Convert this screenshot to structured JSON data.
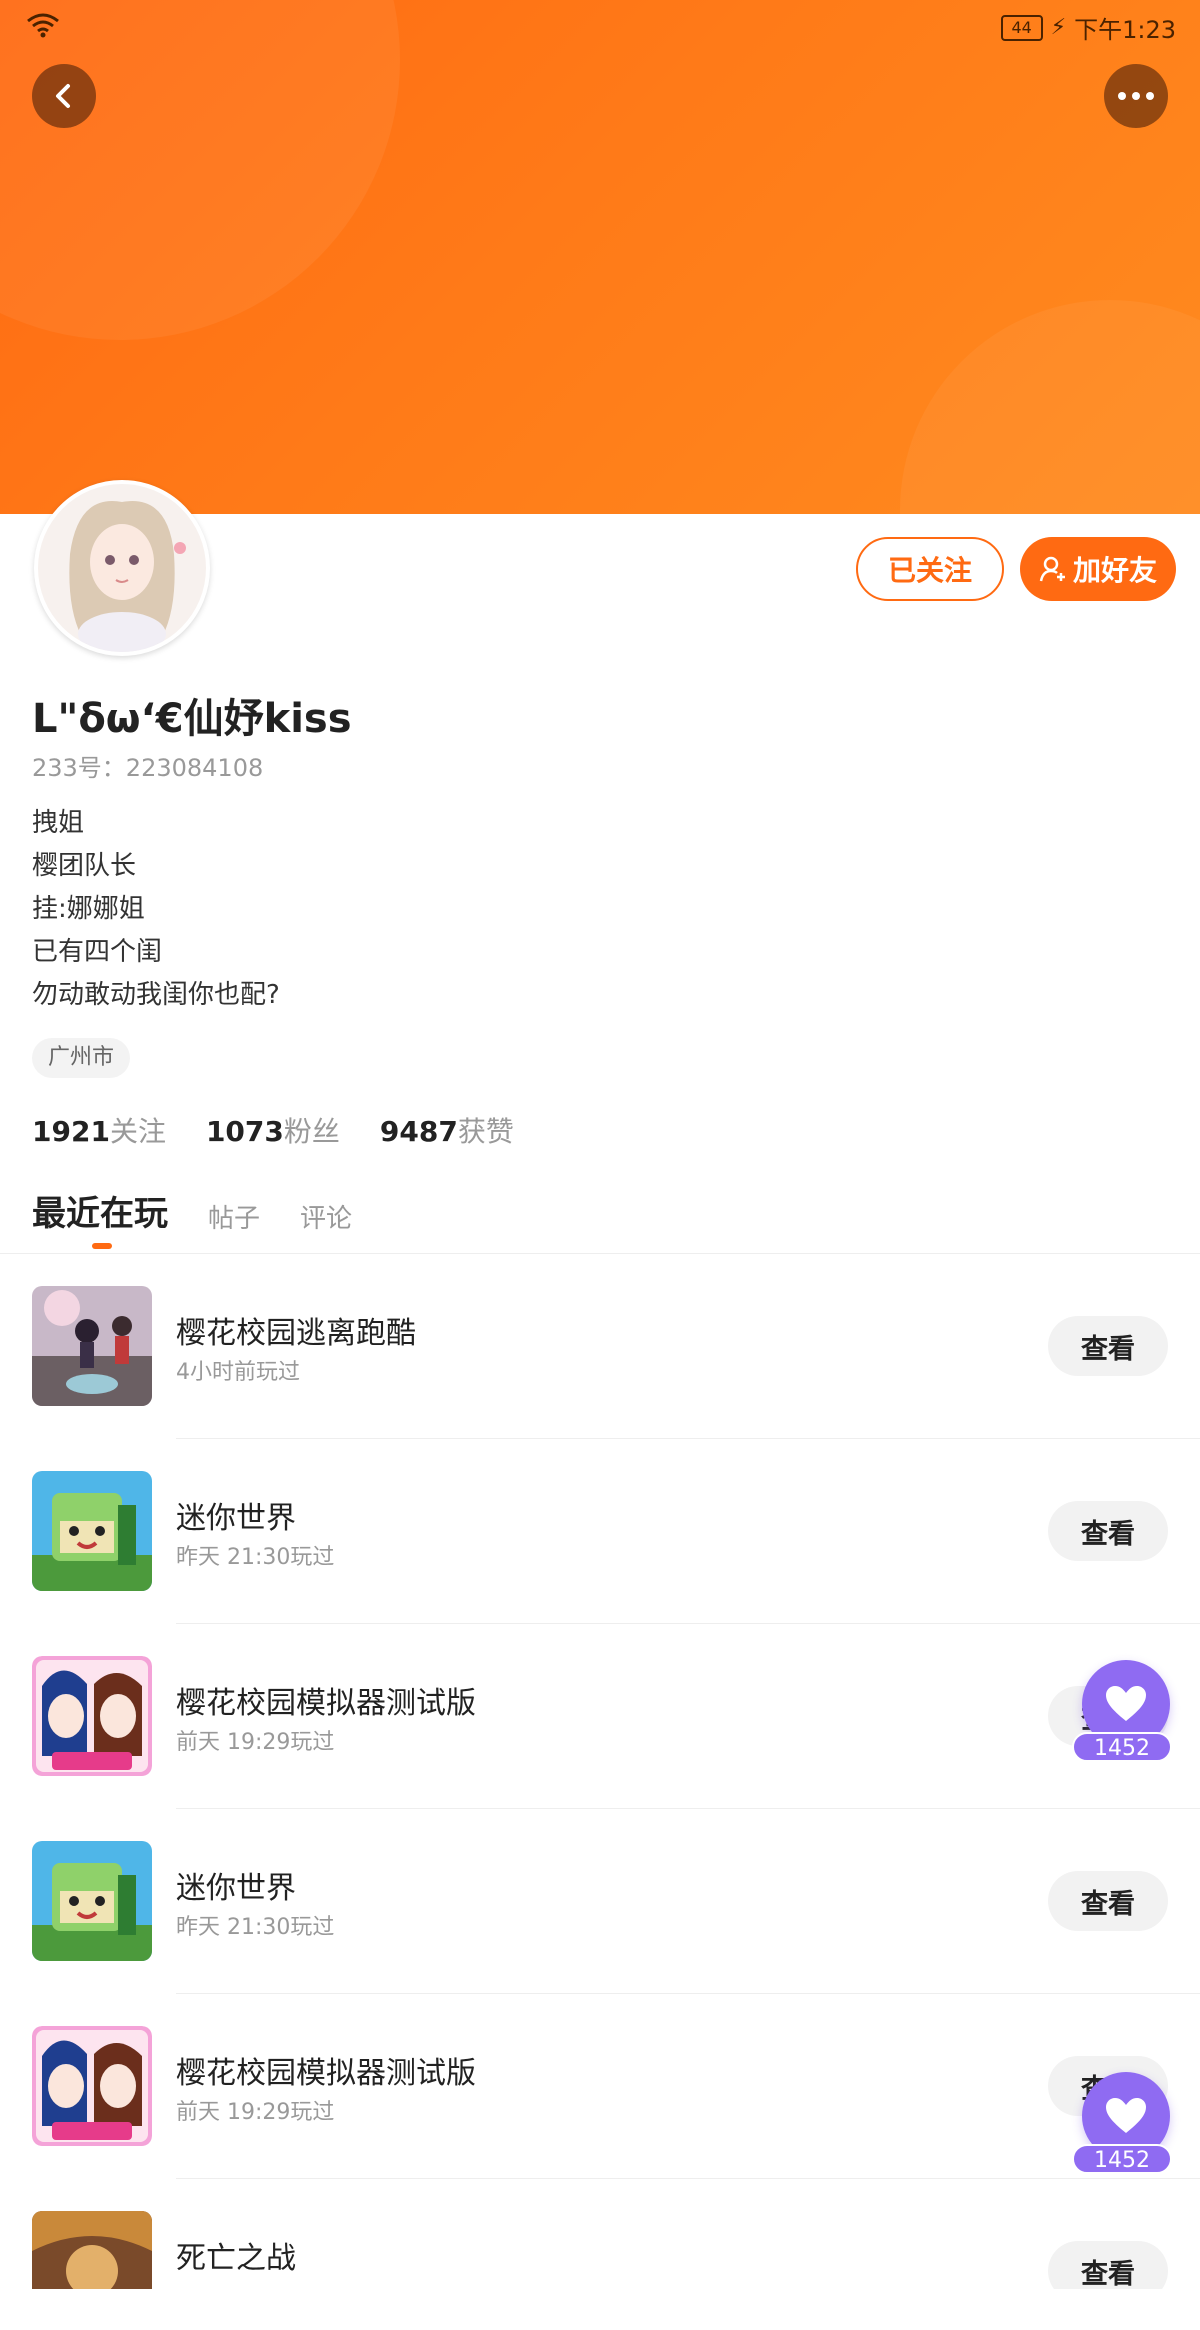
{
  "status_bar": {
    "battery": "44",
    "time": "下午1:23"
  },
  "profile": {
    "username": "L\"δω‘€仙妤kiss",
    "id_text": "233号：223084108",
    "bio": [
      "拽姐",
      "樱团队长",
      "挂:娜娜姐",
      "已有四个闺",
      "勿动敢动我闺你也配?"
    ],
    "location": "广州市",
    "follow_button": "已关注",
    "add_friend_button": "加好友",
    "stats": [
      {
        "num": "1921",
        "label": "关注"
      },
      {
        "num": "1073",
        "label": "粉丝"
      },
      {
        "num": "9487",
        "label": "获赞"
      }
    ]
  },
  "tabs": [
    {
      "label": "最近在玩",
      "active": true
    },
    {
      "label": "帖子",
      "active": false
    },
    {
      "label": "评论",
      "active": false
    }
  ],
  "games": [
    {
      "name": "樱花校园逃离跑酷",
      "time": "4小时前玩过",
      "button": "查看",
      "icon": "sakura-parkour-icon"
    },
    {
      "name": "迷你世界",
      "time": "昨天 21:30玩过",
      "button": "查看",
      "icon": "mini-world-icon"
    },
    {
      "name": "樱花校园模拟器测试版",
      "time": "前天 19:29玩过",
      "button": "查看",
      "icon": "sakura-simulator-icon"
    },
    {
      "name": "迷你世界",
      "time": "昨天 21:30玩过",
      "button": "查看",
      "icon": "mini-world-icon"
    },
    {
      "name": "樱花校园模拟器测试版",
      "time": "前天 19:29玩过",
      "button": "查看",
      "icon": "sakura-simulator-icon"
    },
    {
      "name": "死亡之战",
      "time": "",
      "button": "查看",
      "icon": "death-war-icon"
    }
  ],
  "like_fab": {
    "count": "1452"
  },
  "colors": {
    "accent": "#ff6a12",
    "fab": "#8f6bf2"
  }
}
